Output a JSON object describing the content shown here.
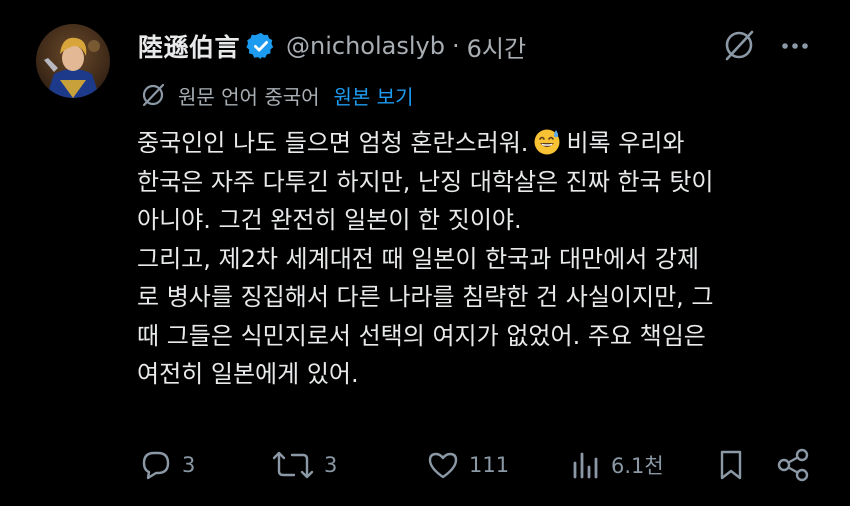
{
  "header": {
    "display_name": "陸遜伯言",
    "handle": "@nicholaslyb",
    "separator": "·",
    "time": "6시간"
  },
  "translation": {
    "note": "원문 언어 중국어",
    "show_original": "원본 보기"
  },
  "tweet": {
    "lines": [
      "중국인인 나도 들으면 엄청 혼란스러워.",
      "비록 우리와",
      "한국은 자주 다투긴 하지만, 난징 대학살은 진짜 한국 탓이",
      "아니야. 그건 완전히 일본이 한 짓이야.",
      "그리고, 제2차 세계대전 때 일본이 한국과 대만에서 강제",
      "로 병사를 징집해서 다른 나라를 침략한 건 사실이지만, 그",
      "때 그들은 식민지로서 선택의 여지가 없었어. 주요 책임은",
      "여전히 일본에게 있어."
    ]
  },
  "actions": {
    "reply_count": "3",
    "repost_count": "3",
    "like_count": "111",
    "views_count": "6.1천"
  },
  "colors": {
    "background": "#000000",
    "text": "#e7e9ea",
    "muted": "#8b98a5",
    "link": "#1d9bf0",
    "verified": "#1d9bf0"
  }
}
